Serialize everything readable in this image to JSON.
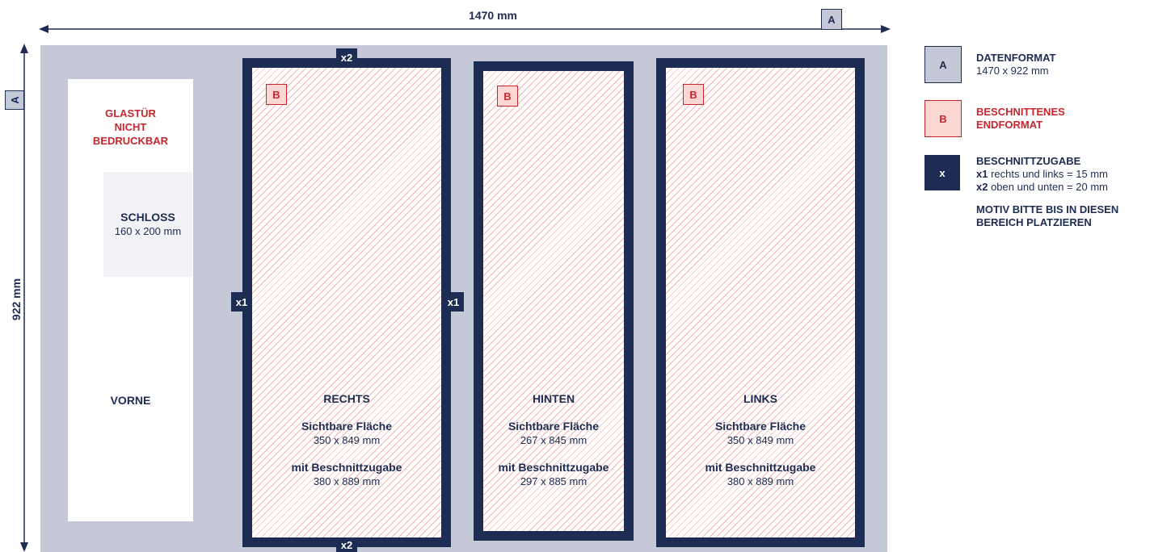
{
  "dimensions": {
    "width_label": "1470 mm",
    "height_label": "922 mm",
    "width_tag": "A",
    "height_tag": "A"
  },
  "door": {
    "glass_label": [
      "GLASTÜR",
      "NICHT",
      "BEDRUCKBAR"
    ],
    "lock_title": "SCHLOSS",
    "lock_size": "160 x 200 mm",
    "front_label": "VORNE"
  },
  "panels": [
    {
      "tag": "B",
      "name": "RECHTS",
      "visible_label": "Sichtbare Fläche",
      "visible_size": "350 x 849 mm",
      "bleed_label": "mit Beschnittzugabe",
      "bleed_size": "380 x 889 mm",
      "marker_top": "x2",
      "marker_bottom": "x2",
      "marker_left": "x1",
      "marker_right": "x1"
    },
    {
      "tag": "B",
      "name": "HINTEN",
      "visible_label": "Sichtbare Fläche",
      "visible_size": "267 x 845 mm",
      "bleed_label": "mit Beschnittzugabe",
      "bleed_size": "297 x 885 mm"
    },
    {
      "tag": "B",
      "name": "LINKS",
      "visible_label": "Sichtbare Fläche",
      "visible_size": "350 x 849 mm",
      "bleed_label": "mit Beschnittzugabe",
      "bleed_size": "380 x 889 mm"
    }
  ],
  "legend": {
    "a": {
      "tag": "A",
      "title": "DATENFORMAT",
      "text": "1470 x 922 mm"
    },
    "b": {
      "tag": "B",
      "title_lines": [
        "BESCHNITTENES",
        "ENDFORMAT"
      ]
    },
    "x": {
      "tag": "x",
      "title": "BESCHNITTZUGABE",
      "x1_key": "x1",
      "x1_text": " rechts und links = 15 mm",
      "x2_key": "x2",
      "x2_text": " oben und unten = 20 mm",
      "note_lines": [
        "MOTIV BITTE BIS IN DIESEN",
        "BEREICH PLATZIEREN"
      ]
    }
  },
  "colors": {
    "navy": "#1c2c52",
    "red": "#c8262e",
    "gray_bg": "#c5c8d6",
    "pink": "#fbd6d3"
  }
}
